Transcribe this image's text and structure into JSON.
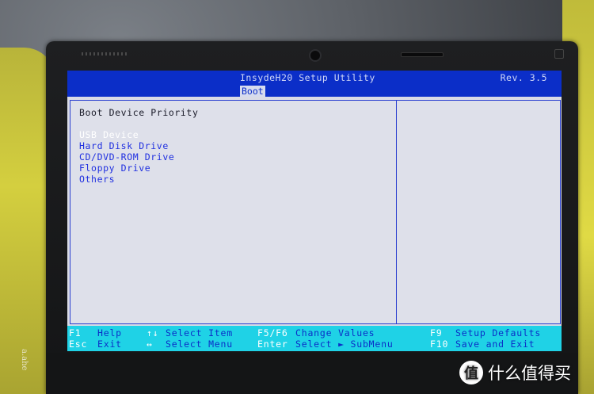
{
  "bios": {
    "title": "InsydeH20 Setup Utility",
    "revision": "Rev. 3.5",
    "active_tab": "Boot",
    "section_heading": "Boot Device Priority",
    "boot_devices": [
      {
        "label": "USB Device",
        "selected": true
      },
      {
        "label": "Hard Disk Drive",
        "selected": false
      },
      {
        "label": "CD/DVD-ROM Drive",
        "selected": false
      },
      {
        "label": "Floppy Drive",
        "selected": false
      },
      {
        "label": "Others",
        "selected": false
      }
    ]
  },
  "help_bar": {
    "row1": [
      {
        "key": "F1",
        "desc": "Help"
      },
      {
        "key": "↑↓",
        "desc": "Select Item"
      },
      {
        "key": "F5/F6",
        "desc": "Change Values"
      },
      {
        "key": "F9",
        "desc": "Setup Defaults"
      }
    ],
    "row2": [
      {
        "key": "Esc",
        "desc": "Exit"
      },
      {
        "key": "↔",
        "desc": "Select Menu"
      },
      {
        "key": "Enter",
        "desc": "Select ► SubMenu"
      },
      {
        "key": "F10",
        "desc": "Save and Exit"
      }
    ]
  },
  "watermark": {
    "logo": "值",
    "text": "什么值得买"
  },
  "signature": {
    "text": "a.ahe"
  },
  "colors": {
    "bios_blue": "#0b2ec8",
    "bios_gray": "#d9dbe6",
    "help_cyan": "#1fd2e6",
    "item_blue": "#1f2fe0",
    "selected_white": "#ffffff"
  }
}
